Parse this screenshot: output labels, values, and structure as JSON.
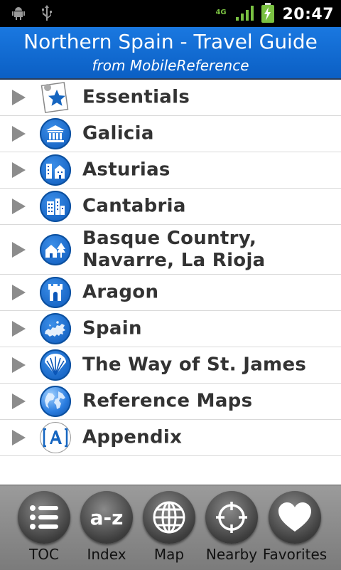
{
  "status_bar": {
    "time": "20:47",
    "network": "4G",
    "icons": [
      "android-icon",
      "usb-icon",
      "network-4g-icon",
      "signal-icon",
      "battery-charging-icon"
    ]
  },
  "header": {
    "title": "Northern Spain - Travel Guide",
    "subtitle": "from MobileReference"
  },
  "toc": {
    "items": [
      {
        "label": "Essentials",
        "icon": "star-page-icon"
      },
      {
        "label": "Galicia",
        "icon": "museum-icon"
      },
      {
        "label": "Asturias",
        "icon": "town-icon"
      },
      {
        "label": "Cantabria",
        "icon": "buildings-icon"
      },
      {
        "label": "Basque Country, Navarre, La Rioja",
        "icon": "house-tree-icon"
      },
      {
        "label": "Aragon",
        "icon": "castle-tower-icon"
      },
      {
        "label": "Spain",
        "icon": "europe-map-icon"
      },
      {
        "label": "The Way of St. James",
        "icon": "scallop-shell-icon"
      },
      {
        "label": "Reference Maps",
        "icon": "globe-icon"
      },
      {
        "label": "Appendix",
        "icon": "bracket-a-icon"
      }
    ]
  },
  "tabbar": {
    "tabs": [
      {
        "label": "TOC",
        "icon": "list-icon"
      },
      {
        "label": "Index",
        "icon": "a-z-icon",
        "glyph": "a-z"
      },
      {
        "label": "Map",
        "icon": "globe-grid-icon"
      },
      {
        "label": "Nearby",
        "icon": "crosshair-icon"
      },
      {
        "label": "Favorites",
        "icon": "heart-icon"
      }
    ]
  },
  "colors": {
    "header_blue": "#0b5fc4",
    "icon_blue": "#0a56b8",
    "label_text": "#333333",
    "arrow_gray": "#8c8c8c",
    "tabbar_gray": "#8a8a8a"
  }
}
